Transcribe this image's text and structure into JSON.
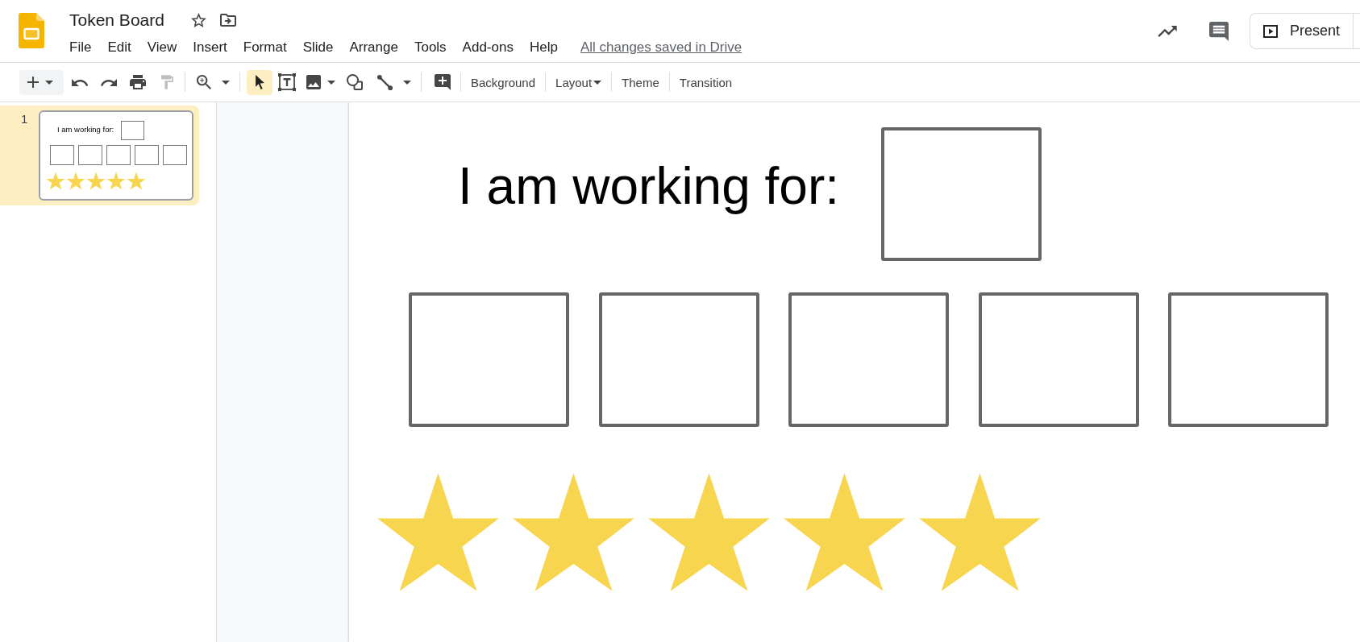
{
  "document": {
    "title": "Token Board",
    "save_status": "All changes saved in Drive"
  },
  "menu_bar": [
    "File",
    "Edit",
    "View",
    "Insert",
    "Format",
    "Slide",
    "Arrange",
    "Tools",
    "Add-ons",
    "Help"
  ],
  "present_button": {
    "label": "Present"
  },
  "toolbar": {
    "edit_tools": [
      {
        "kind": "new-slide",
        "disabled": false
      },
      {
        "kind": "undo",
        "disabled": false
      },
      {
        "kind": "redo",
        "disabled": false
      },
      {
        "kind": "print",
        "disabled": false
      },
      {
        "kind": "paint-format",
        "disabled": true
      }
    ],
    "insert_tools": [
      {
        "kind": "select",
        "selected": true
      },
      {
        "kind": "text-box",
        "selected": false
      },
      {
        "kind": "image",
        "selected": false
      },
      {
        "kind": "shape",
        "selected": false
      },
      {
        "kind": "line",
        "selected": false
      }
    ],
    "slide_buttons": [
      {
        "kind": "button",
        "label": "Background"
      },
      {
        "kind": "menu",
        "label": "Layout"
      },
      {
        "kind": "button",
        "label": "Theme"
      },
      {
        "kind": "button",
        "label": "Transition"
      }
    ]
  },
  "filmstrip": [
    {
      "number": "1",
      "selected": true,
      "thumbnail": {
        "text": "I am working for:",
        "stars": 5
      }
    }
  ],
  "slide": {
    "text": "I am working for:",
    "stars": 5
  }
}
